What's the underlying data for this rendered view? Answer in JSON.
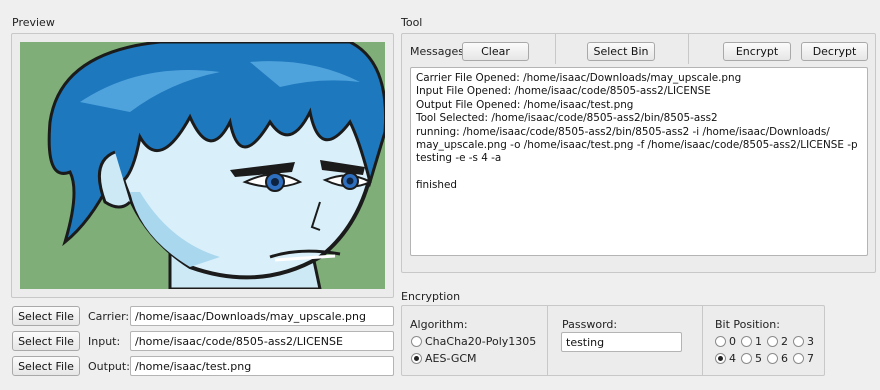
{
  "preview": {
    "title": "Preview"
  },
  "tool": {
    "title": "Tool",
    "messages_label": "Messages",
    "clear_label": "Clear",
    "select_bin_label": "Select Bin",
    "encrypt_label": "Encrypt",
    "decrypt_label": "Decrypt",
    "log": "Carrier File Opened: /home/isaac/Downloads/may_upscale.png\nInput File Opened: /home/isaac/code/8505-ass2/LICENSE\nOutput File Opened: /home/isaac/test.png\nTool Selected: /home/isaac/code/8505-ass2/bin/8505-ass2\nrunning: /home/isaac/code/8505-ass2/bin/8505-ass2 -i /home/isaac/Downloads/\nmay_upscale.png -o /home/isaac/test.png -f /home/isaac/code/8505-ass2/LICENSE -p\ntesting -e -s 4 -a\n\nfinished"
  },
  "files": {
    "select_file_label": "Select File",
    "carrier_label": "Carrier:",
    "carrier_value": "/home/isaac/Downloads/may_upscale.png",
    "input_label": "Input:",
    "input_value": "/home/isaac/code/8505-ass2/LICENSE",
    "output_label": "Output:",
    "output_value": "/home/isaac/test.png"
  },
  "encryption": {
    "title": "Encryption",
    "algorithm_label": "Algorithm:",
    "algorithms": [
      "ChaCha20-Poly1305",
      "AES-GCM"
    ],
    "selected_algorithm": "AES-GCM",
    "password_label": "Password:",
    "password_value": "testing",
    "bit_position_label": "Bit Position:",
    "bit_positions": [
      "0",
      "1",
      "2",
      "3",
      "4",
      "5",
      "6",
      "7"
    ],
    "selected_bit": "4"
  },
  "colors": {
    "window_bg": "#efefef",
    "preview_bg": "#7fae78",
    "hair": "#1a6fb3"
  }
}
